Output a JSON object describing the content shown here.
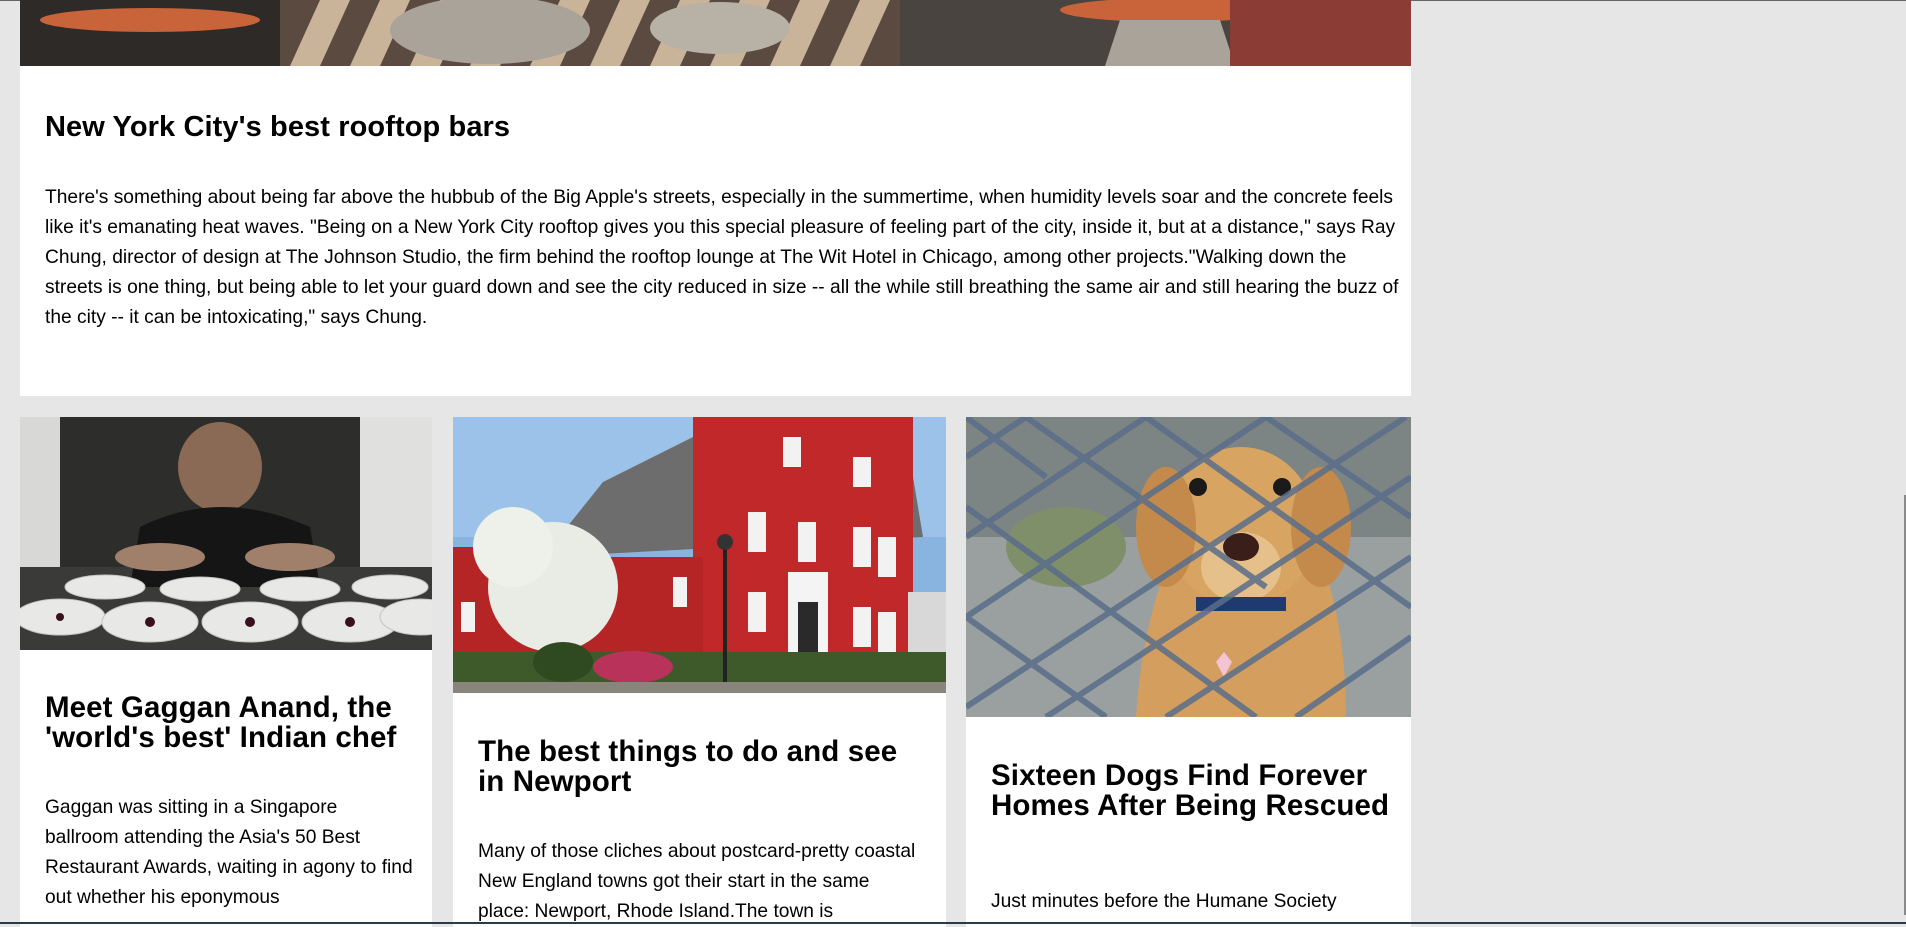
{
  "hero": {
    "title": "New York City's best rooftop bars",
    "body": "There's something about being far above the hubbub of the Big Apple's streets, especially in the summertime, when humidity levels soar and the concrete feels like it's emanating heat waves. \"Being on a New York City rooftop gives you this special pleasure of feeling part of the city, inside it, but at a distance,\" says Ray Chung, director of design at The Johnson Studio, the firm behind the rooftop lounge at The Wit Hotel in Chicago, among other projects.\"Walking down the streets is one thing, but being able to let your guard down and see the city reduced in size -- all the while still breathing the same air and still hearing the buzz of the city -- it can be intoxicating,\" says Chung."
  },
  "cards": [
    {
      "title": "Meet Gaggan Anand, the 'world's best' Indian chef",
      "body": "Gaggan was sitting in a Singapore ballroom attending the Asia's 50 Best Restaurant Awards, waiting in agony to find out whether his eponymous"
    },
    {
      "title": "The best things to do and see in Newport",
      "body": "Many of those cliches about postcard-pretty coastal New England towns got their start in the same place: Newport, Rhode Island.The town is"
    },
    {
      "title": "Sixteen Dogs Find Forever Homes After Being Rescued",
      "body": "Just minutes before the Humane Society"
    }
  ],
  "colors": {
    "page_bg": "#e6e6e6",
    "card_bg": "#ffffff",
    "text": "#000000"
  }
}
